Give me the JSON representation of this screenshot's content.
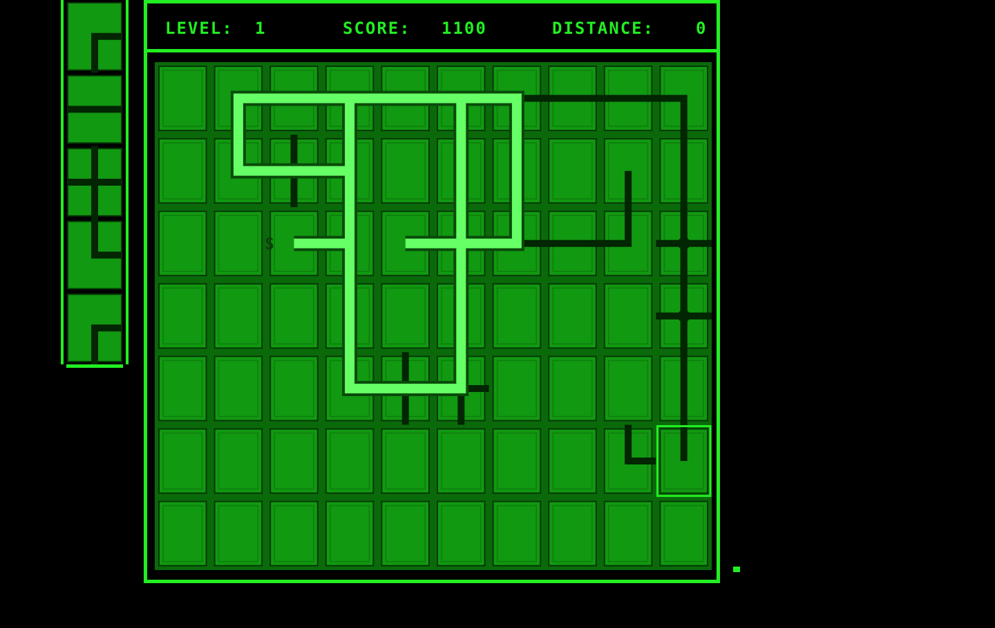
{
  "hud": {
    "level_label": "LEVEL:",
    "level_value": "1",
    "score_label": "SCORE:",
    "score_value": "1100",
    "distance_label": "DISTANCE:",
    "distance_value": "0"
  },
  "board": {
    "cols": 10,
    "rows": 7,
    "start_marker": "S",
    "start_cell": [
      2,
      2
    ],
    "cursor_cell": [
      9,
      5
    ],
    "flowed_path": [
      [
        4,
        2
      ],
      [
        6,
        2
      ],
      [
        6,
        0
      ],
      [
        3,
        0
      ],
      [
        3,
        4
      ],
      [
        5,
        4
      ],
      [
        5,
        0
      ],
      [
        1,
        0
      ],
      [
        1,
        1
      ],
      [
        3,
        1
      ],
      [
        3,
        2
      ],
      [
        2,
        2
      ]
    ],
    "empty_pipes": [
      {
        "type": "cross",
        "cell": [
          2,
          1
        ]
      },
      {
        "type": "cross",
        "cell": [
          5,
          2
        ]
      },
      {
        "type": "cross",
        "cell": [
          4,
          4
        ]
      },
      {
        "type": "cross",
        "cell": [
          5,
          4
        ]
      },
      {
        "type": "cross",
        "cell": [
          9,
          2
        ]
      },
      {
        "type": "cross",
        "cell": [
          9,
          3
        ]
      },
      {
        "type": "corner",
        "cell": [
          8,
          5
        ]
      }
    ],
    "empty_loop": [
      [
        5,
        0
      ],
      [
        9,
        0
      ],
      [
        9,
        5
      ]
    ],
    "empty_loop_left": [
      [
        5,
        0
      ],
      [
        5,
        2
      ],
      [
        8,
        2
      ],
      [
        8,
        1
      ]
    ]
  },
  "queue": {
    "pieces": [
      "elbow-down-right",
      "horizontal",
      "cross",
      "elbow-up-right",
      "elbow-down-right"
    ]
  },
  "colors": {
    "background": "#000000",
    "bright": "#22ee22",
    "tile": "#119911",
    "tile_edge": "#0a6a0a",
    "flow": "#66ff66"
  }
}
